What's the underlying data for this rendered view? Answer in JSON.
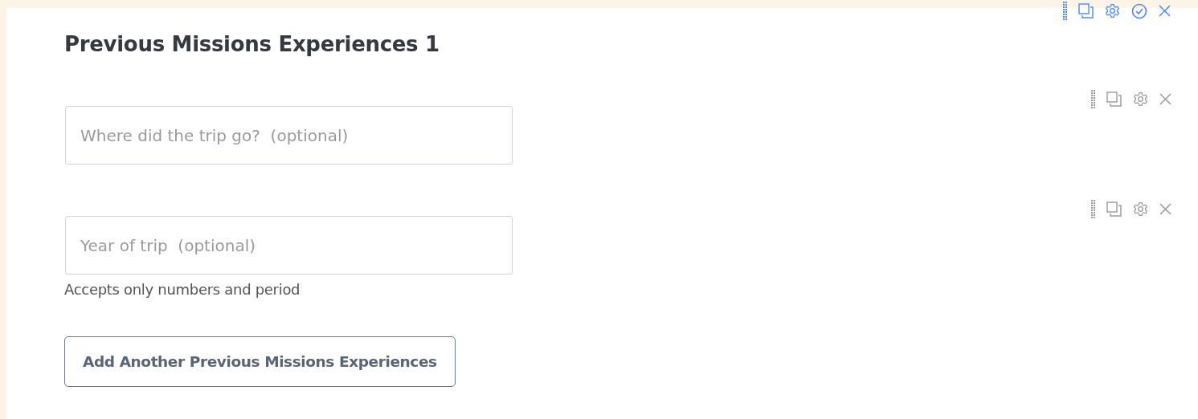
{
  "section": {
    "title": "Previous Missions Experiences 1"
  },
  "fields": [
    {
      "placeholder": "Where did the trip go?  (optional)"
    },
    {
      "placeholder": "Year of trip  (optional)",
      "help": "Accepts only numbers and period"
    }
  ],
  "add_button": "Add Another Previous Missions Experiences"
}
